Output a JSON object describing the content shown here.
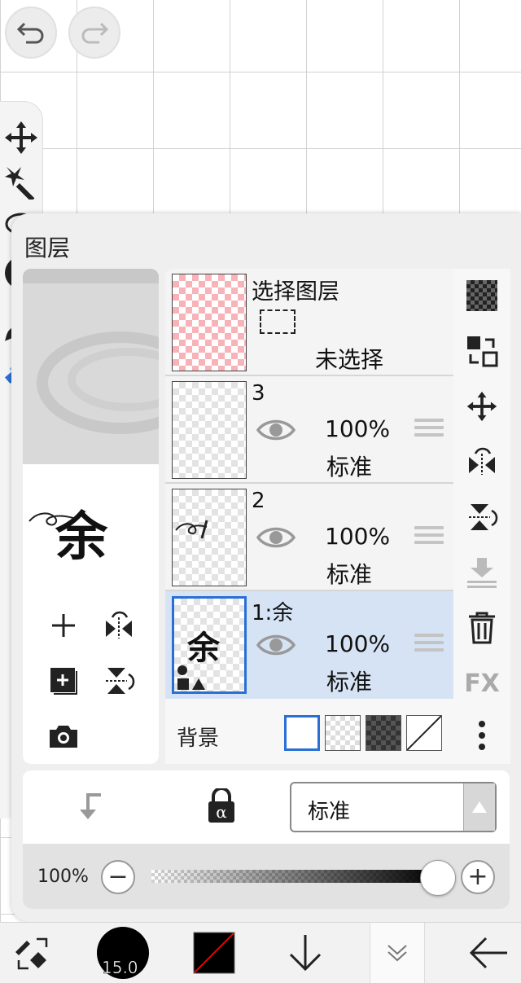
{
  "top_buttons": {
    "undo": "undo-icon",
    "redo": "redo-icon"
  },
  "panel": {
    "title": "图层"
  },
  "selection_layer": {
    "name": "选择图层",
    "status": "未选择"
  },
  "layers": [
    {
      "name": "3",
      "opacity": "100%",
      "mode": "标准"
    },
    {
      "name": "2",
      "opacity": "100%",
      "mode": "标准"
    },
    {
      "name": "1:余",
      "opacity": "100%",
      "mode": "标准",
      "selected": true
    }
  ],
  "preview": {
    "glyph": "余",
    "thumb_glyph": "余"
  },
  "background": {
    "label": "背景",
    "options": [
      "white",
      "checker-light",
      "checker-dark",
      "transparent"
    ],
    "selected": "white"
  },
  "right_tools": [
    "checker-icon",
    "swap-layer-icon",
    "move-icon",
    "flip-horizontal-icon",
    "flip-vertical-icon",
    "merge-down-icon",
    "trash-icon",
    "fx-icon",
    "more-icon"
  ],
  "fx_label": "FX",
  "blend_mode": {
    "value": "标准"
  },
  "opacity": {
    "label": "100%",
    "value": 1.0
  },
  "brush_size": "15.0",
  "colors": {
    "accent": "#2a6fd6",
    "selected_row": "#d6e3f5",
    "pink": "#f7b3b8"
  }
}
